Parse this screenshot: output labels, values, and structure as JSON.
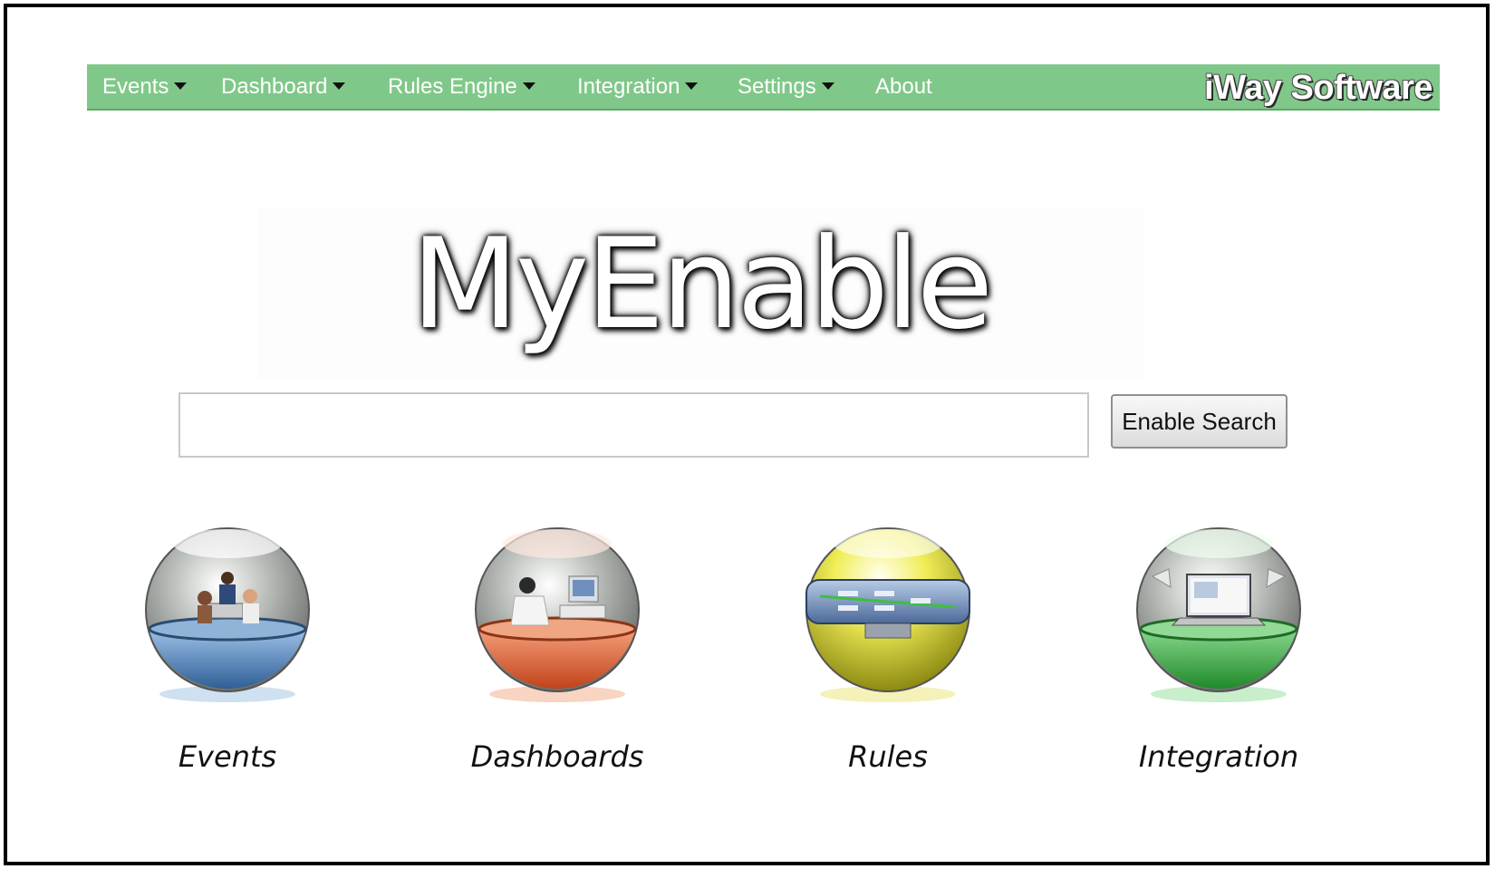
{
  "navbar": {
    "items": [
      {
        "label": "Events",
        "has_dropdown": true
      },
      {
        "label": "Dashboard",
        "has_dropdown": true
      },
      {
        "label": "Rules Engine",
        "has_dropdown": true
      },
      {
        "label": "Integration",
        "has_dropdown": true
      },
      {
        "label": "Settings",
        "has_dropdown": true
      },
      {
        "label": "About",
        "has_dropdown": false
      }
    ],
    "brand": "iWay Software",
    "background_color": "#80c889"
  },
  "logo": {
    "text": "MyEnable"
  },
  "search": {
    "value": "",
    "placeholder": "",
    "button_label": "Enable Search"
  },
  "tiles": [
    {
      "label": "Events",
      "icon": "people-meeting-sphere-icon",
      "color": "#4f84bb"
    },
    {
      "label": "Dashboards",
      "icon": "person-at-computer-sphere-icon",
      "color": "#e0663a"
    },
    {
      "label": "Rules",
      "icon": "rules-diagram-sphere-icon",
      "color": "#e6e02a"
    },
    {
      "label": "Integration",
      "icon": "laptop-sphere-icon",
      "color": "#3ca844"
    }
  ]
}
